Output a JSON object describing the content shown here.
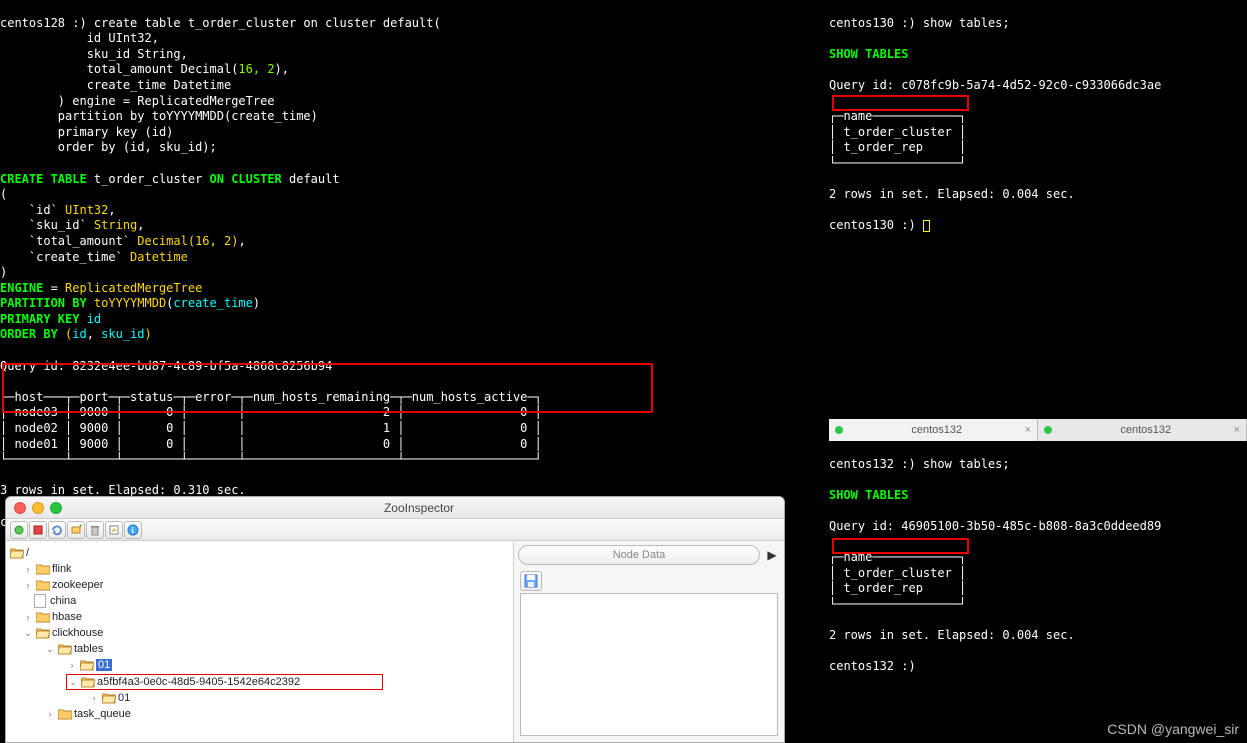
{
  "term128": {
    "prompt": "centos128 :) ",
    "l1": "create table t_order_cluster on cluster default(",
    "l2": "            id UInt32,",
    "l3": "            sku_id String,",
    "l4": "            total_amount Decimal(",
    "l4n": "16, 2",
    "l4e": "),",
    "l5": "            create_time Datetime",
    "l6": "        ) engine = ReplicatedMergeTree",
    "l7": "        partition by toYYYYMMDD(create_time)",
    "l8": "        primary key (id)",
    "l9": "        order by (id, sku_id);",
    "p1_a": "CREATE TABLE ",
    "p1_b": "t_order_cluster ",
    "p1_c": "ON CLUSTER ",
    "p1_d": "default",
    "p2": "(",
    "p3_a": "    `id` ",
    "p3_b": "UInt32",
    "p4_a": "    `sku_id` ",
    "p4_b": "String",
    "p5_a": "    `total_amount` ",
    "p5_b": "Decimal(16, 2)",
    "p6_a": "    `create_time` ",
    "p6_b": "Datetime",
    "p7": ")",
    "p8_a": "ENGINE ",
    "p8_b": "= ",
    "p8_c": "ReplicatedMergeTree",
    "p9_a": "PARTITION BY ",
    "p9_b": "toYYYYMMDD",
    "p9_c": "(",
    "p9_d": "create_time",
    "p9_e": ")",
    "p10_a": "PRIMARY KEY ",
    "p10_b": "id",
    "p11_a": "ORDER BY ",
    "p11_b": "(",
    "p11_c": "id",
    "p11_d": ", ",
    "p11_e": "sku_id",
    "p11_f": ")",
    "qid": "Query id: 8232e4ee-bd87-4c89-bf5a-4868c8256b94",
    "tbl_hdr": "┌─host───┬─port─┬─status─┬─error─┬─num_hosts_remaining─┬─num_hosts_active─┐",
    "tbl_r1": "│ node03 │ 9000 │      0 │       │                   2 │                0 │",
    "tbl_r2": "│ node02 │ 9000 │      0 │       │                   1 │                0 │",
    "tbl_r3": "│ node01 │ 9000 │      0 │       │                   0 │                0 │",
    "tbl_ftr": "└────────┴──────┴────────┴───────┴─────────────────────┴──────────────────┘",
    "elapsed": "3 rows in set. Elapsed: 0.310 sec.",
    "prompt2": "centos128 :) "
  },
  "term130": {
    "l1": "centos130 :) show tables;",
    "l2": "SHOW TABLES",
    "qid": "Query id: c078fc9b-5a74-4d52-92c0-c933066dc3ae",
    "hdr": "┌─name────────────┐",
    "r1": "│ t_order_cluster │",
    "r2": "│ t_order_rep     │",
    "ftr": "└─────────────────┘",
    "elapsed": "2 rows in set. Elapsed: 0.004 sec.",
    "prompt": "centos130 :) "
  },
  "term132": {
    "l1": "centos132 :) show tables;",
    "l2": "SHOW TABLES",
    "qid": "Query id: 46905100-3b50-485c-b808-8a3c0ddeed89",
    "hdr": "┌─name────────────┐",
    "r1": "│ t_order_cluster │",
    "r2": "│ t_order_rep     │",
    "ftr": "└─────────────────┘",
    "elapsed": "2 rows in set. Elapsed: 0.004 sec.",
    "prompt": "centos132 :)"
  },
  "tabs": {
    "t1": "centos132",
    "t2": "centos132"
  },
  "zoo": {
    "title": "ZooInspector",
    "node_data": "Node Data",
    "tree": {
      "root": "/",
      "flink": "flink",
      "zookeeper": "zookeeper",
      "china": "china",
      "hbase": "hbase",
      "clickhouse": "clickhouse",
      "tables": "tables",
      "n01": "01",
      "uuid": "a5fbf4a3-0e0c-48d5-9405-1542e64c2392",
      "n01b": "01",
      "task_queue": "task_queue"
    }
  },
  "watermark": "CSDN @yangwei_sir"
}
